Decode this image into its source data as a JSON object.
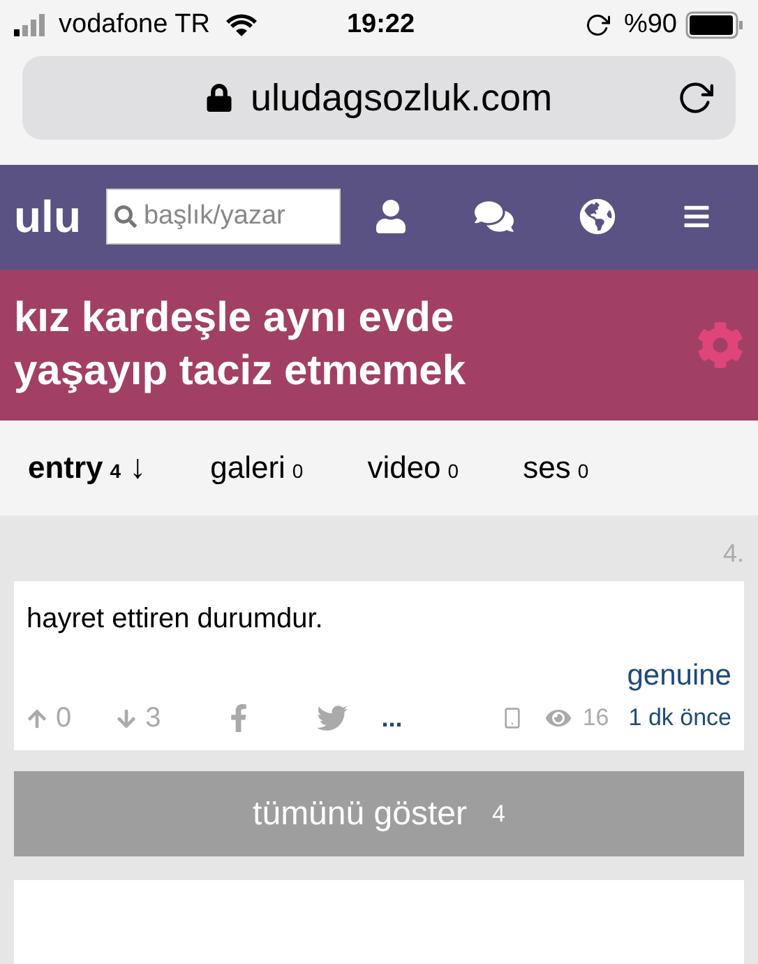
{
  "status_bar": {
    "carrier": "vodafone TR",
    "time": "19:22",
    "battery": "%90"
  },
  "url_bar": {
    "address": "uludagsozluk.com"
  },
  "header": {
    "logo": "ulu",
    "search": {
      "placeholder": "başlık/yazar"
    }
  },
  "topic": {
    "title": "kız kardeşle aynı evde yaşayıp taciz etmemek"
  },
  "tabs": [
    {
      "label": "entry",
      "count": "4",
      "sort": "↓",
      "selected": true
    },
    {
      "label": "galeri",
      "count": "0",
      "selected": false
    },
    {
      "label": "video",
      "count": "0",
      "selected": false
    },
    {
      "label": "ses",
      "count": "0",
      "selected": false
    }
  ],
  "entries": [
    {
      "number": "4.",
      "text": "hayret ettiren durumdur.",
      "author": "genuine",
      "upvotes": "0",
      "downvotes": "3",
      "more": "...",
      "views": "16",
      "time": "1 dk önce"
    }
  ],
  "show_all": {
    "label": "tümünü göster",
    "count": "4"
  }
}
